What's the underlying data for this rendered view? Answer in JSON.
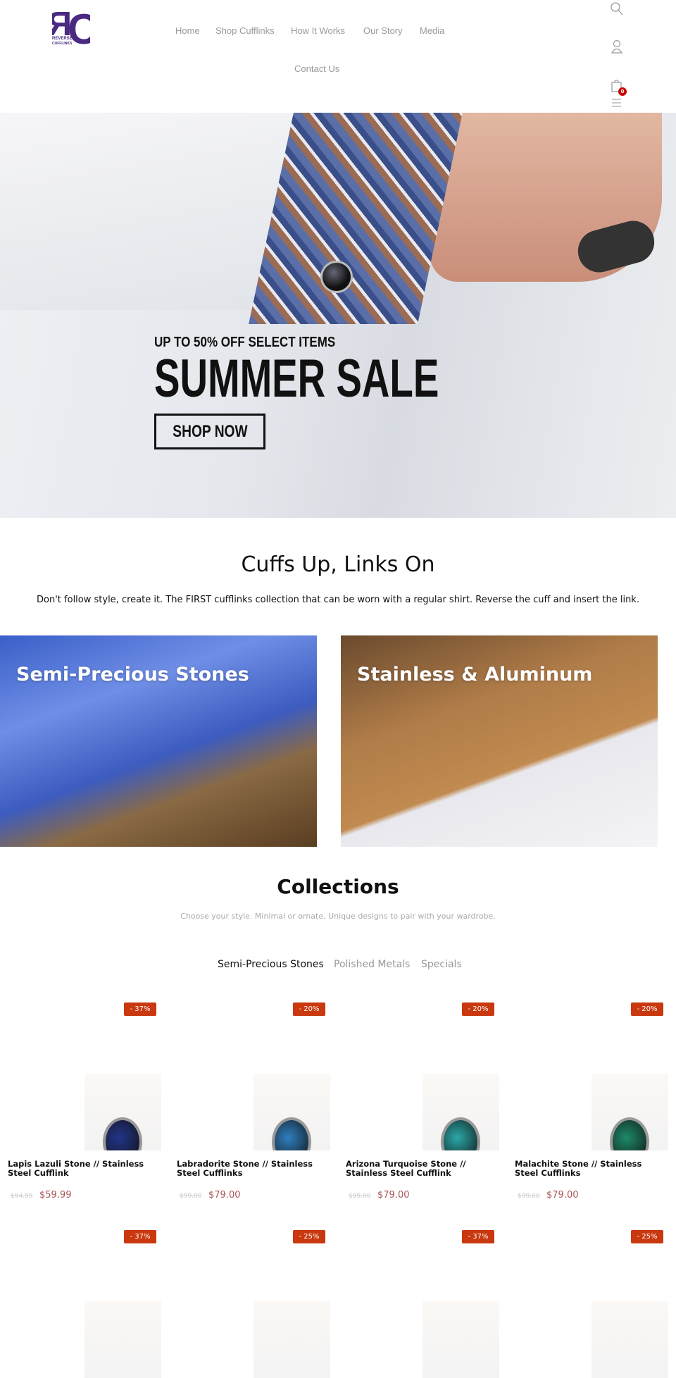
{
  "header": {
    "logo_text": "RC REVERSE CUFFLINKS",
    "logo_color": "#4a2a82",
    "nav": [
      "Home",
      "Shop Cufflinks",
      "How It Works",
      "Our Story",
      "Media",
      "Contact Us"
    ],
    "icons": [
      "search-icon",
      "user-icon",
      "cart-icon",
      "menu-icon"
    ],
    "cart_count": "0"
  },
  "hero": {
    "subtitle": "UP TO 50% OFF SELECT ITEMS",
    "title": "SUMMER SALE",
    "button": "SHOP NOW"
  },
  "intro": {
    "title": "Cuffs Up, Links On",
    "description": "Don't follow style, create it. The FIRST cufflinks collection that can be worn with a regular shirt. Reverse the cuff and insert the link."
  },
  "categories": [
    {
      "label": "Semi-Precious Stones"
    },
    {
      "label": "Stainless & Aluminum"
    }
  ],
  "collections": {
    "title": "Collections",
    "subtitle": "Choose your style. Minimal or ornate. Unique designs to pair with your wardrobe.",
    "tabs": [
      "Semi-Precious Stones",
      "Polished Metals",
      "Specials"
    ],
    "active_tab": "Semi-Precious Stones",
    "discount_color": "#c9380e",
    "products": [
      {
        "discount": "- 37%",
        "title": "Lapis Lazuli Stone // Stainless Steel Cufflink",
        "old_price": "$94.99",
        "price": "$59.99",
        "stone": "#23358a"
      },
      {
        "discount": "- 20%",
        "title": "Labradorite Stone // Stainless Steel Cufflinks",
        "old_price": "$99.00",
        "price": "$79.00",
        "stone": "#2f7fbf"
      },
      {
        "discount": "- 20%",
        "title": "Arizona Turquoise Stone // Stainless Steel Cufflink",
        "old_price": "$99.00",
        "price": "$79.00",
        "stone": "#2aa8a8"
      },
      {
        "discount": "- 20%",
        "title": "Malachite Stone // Stainless Steel Cufflinks",
        "old_price": "$99.00",
        "price": "$79.00",
        "stone": "#1d8a6a"
      },
      {
        "discount": "- 37%"
      },
      {
        "discount": "- 25%"
      },
      {
        "discount": "- 37%"
      },
      {
        "discount": "- 25%"
      }
    ]
  }
}
